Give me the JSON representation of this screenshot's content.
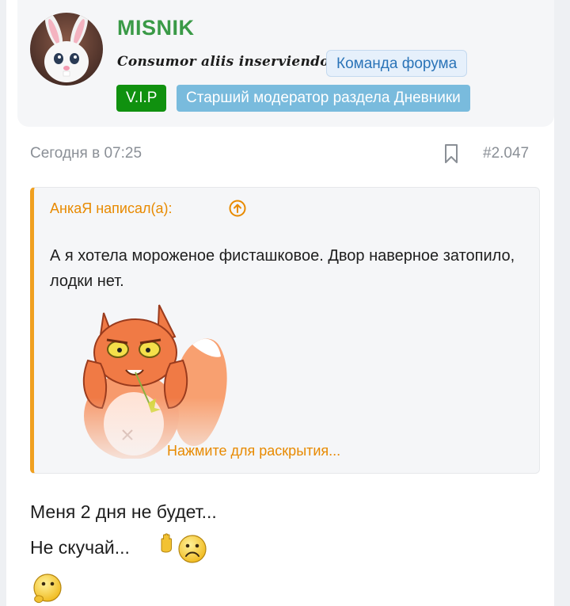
{
  "user": {
    "name": "MISNIK",
    "title": "Consumor aliis inserviendo",
    "team_badge": "Команда форума",
    "vip_badge": "V.I.P",
    "moderator_badge": "Старший модератор раздела Дневники",
    "colors": {
      "name": "#3a9a47",
      "vip": "#10910f",
      "moderator": "#79bbdd",
      "team_text": "#2b74b8"
    }
  },
  "post": {
    "date": "Сегодня в 07:25",
    "number": "#2.047",
    "bookmark_icon": "bookmark-icon"
  },
  "quote": {
    "author": "АнкаЯ написал(а):",
    "text": "А я хотела мороженое фисташковое. Двор наверное затопило, лодки нет.",
    "expand": "Нажмите для раскрытия...",
    "accent": "#f0a020"
  },
  "message": {
    "line1": "Меня 2 дня не будет...",
    "line2": "Не скучай...",
    "emojis": [
      "wave-hand-emoji",
      "frown-emoji",
      "thinking-emoji"
    ]
  }
}
